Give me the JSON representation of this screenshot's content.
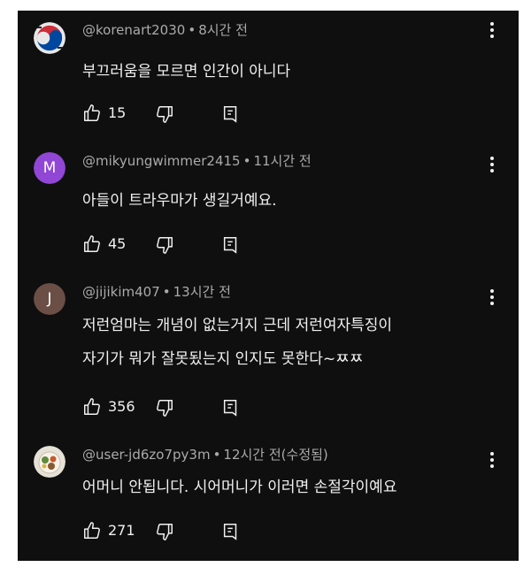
{
  "comments": [
    {
      "avatar_type": "image",
      "avatar_icon": "taegeuk-flag-avatar-icon",
      "author": "@korenart2030",
      "time": "8시간 전",
      "lines": [
        "부끄러움을  모르면 인간이 아니다"
      ],
      "likes": "15"
    },
    {
      "avatar_type": "letter",
      "avatar_letter": "M",
      "avatar_color": "#9146d6",
      "author": "@mikyungwimmer2415",
      "time": "11시간 전",
      "lines": [
        "아들이 트라우마가 생길거예요."
      ],
      "likes": "45"
    },
    {
      "avatar_type": "letter",
      "avatar_letter": "J",
      "avatar_color": "#6b4e45",
      "author": "@jijikim407",
      "time": "13시간 전",
      "lines": [
        "저런엄마는 개념이 없는거지 근데 저런여자특징이",
        "자기가 뭐가 잘못됬는지 인지도 못한다~ㅉㅉ"
      ],
      "likes": "356"
    },
    {
      "avatar_type": "image",
      "avatar_icon": "food-plate-avatar-icon",
      "author": "@user-jd6zo7py3m",
      "time": "12시간 전(수정됨)",
      "lines": [
        "어머니 안됩니다.  시어머니가 이러면 손절각이예요"
      ],
      "likes": "271"
    }
  ],
  "colors": {
    "background": "#0f0f0f",
    "text_primary": "#f1f1f1",
    "text_secondary": "#aaaaaa"
  },
  "icons": [
    "thumbs-up-icon",
    "thumbs-down-icon",
    "reply-icon",
    "more-vert-icon"
  ],
  "meta_separator": "•"
}
